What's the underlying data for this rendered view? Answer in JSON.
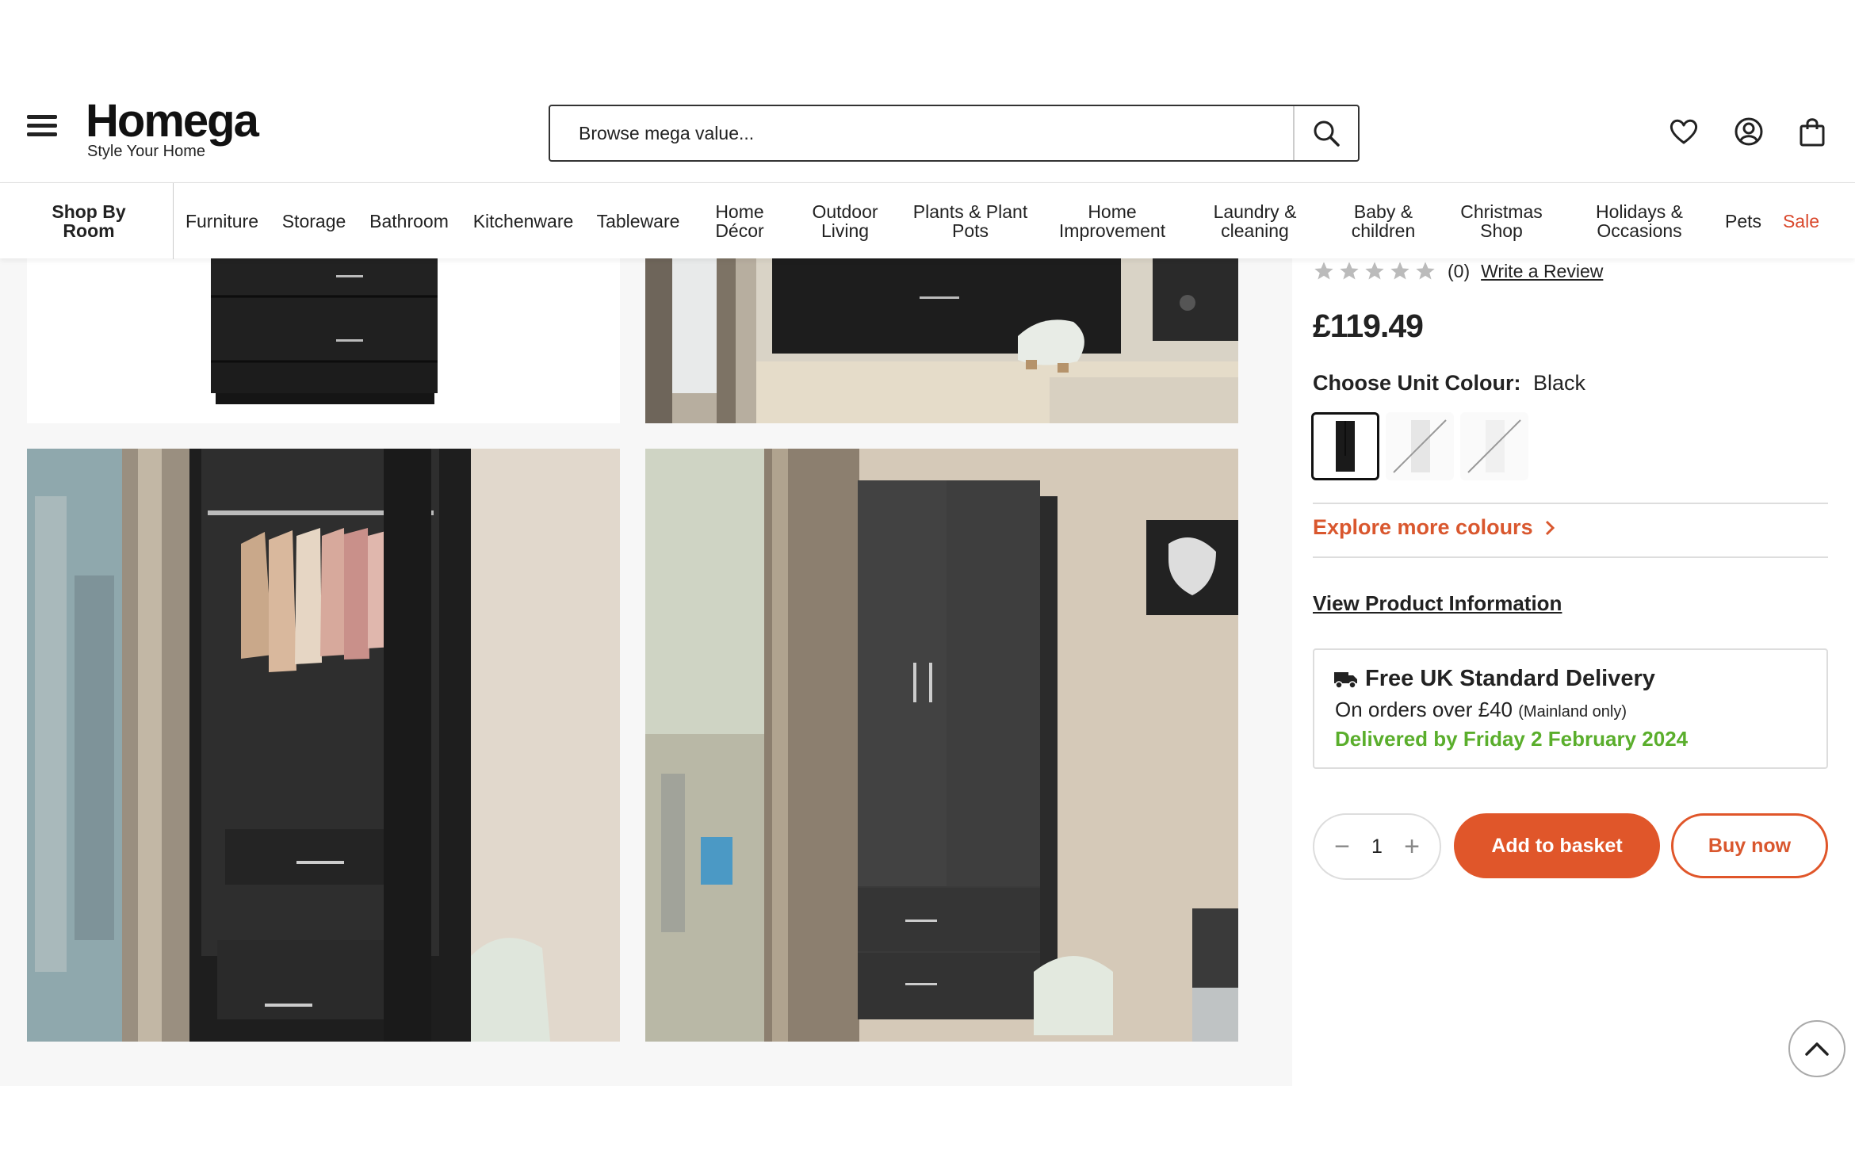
{
  "header": {
    "logo_text": "Homega",
    "tagline": "Style Your Home",
    "search_placeholder": "Browse mega value..."
  },
  "nav": {
    "items": [
      {
        "label": "Shop By Room"
      },
      {
        "label": "Furniture"
      },
      {
        "label": "Storage"
      },
      {
        "label": "Bathroom"
      },
      {
        "label": "Kitchenware"
      },
      {
        "label": "Tableware"
      },
      {
        "label": "Home\nDécor"
      },
      {
        "label": "Outdoor\nLiving"
      },
      {
        "label": "Plants & Plant\nPots"
      },
      {
        "label": "Home\nImprovement"
      },
      {
        "label": "Laundry &\ncleaning"
      },
      {
        "label": "Baby &\nchildren"
      },
      {
        "label": "Christmas\nShop"
      },
      {
        "label": "Holidays &\nOccasions"
      },
      {
        "label": "Pets"
      },
      {
        "label": "Sale"
      }
    ]
  },
  "product": {
    "rating_count": "(0)",
    "write_review": "Write a Review",
    "stars": 0,
    "price": "£119.49",
    "colour_label": "Choose Unit Colour:",
    "colour_value": "Black",
    "explore_colours": "Explore more colours",
    "view_info": "View Product Information",
    "delivery_title": "Free UK Standard Delivery",
    "delivery_sub": "On orders over £40",
    "delivery_sub_small": "(Mainland only)",
    "delivery_date": "Delivered by Friday 2 February 2024",
    "quantity": "1",
    "add_to_basket": "Add to basket",
    "buy_now": "Buy now"
  },
  "colors": {
    "accent": "#e0562a",
    "sale": "#d9472b",
    "delivery_green": "#5aae2c"
  },
  "icons": {
    "menu": "hamburger-menu-icon",
    "search": "search-icon",
    "wishlist": "heart-icon",
    "account": "user-icon",
    "basket": "bag-icon",
    "delivery": "truck-icon",
    "scroll_top": "chevron-up-icon"
  }
}
